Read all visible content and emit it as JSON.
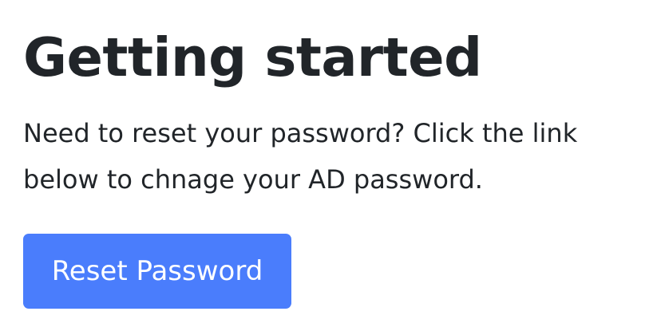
{
  "page": {
    "title": "Getting started",
    "lead_text": "Need to reset your password? Click the link below to chnage your AD password."
  },
  "actions": {
    "reset_button_label": "Reset Password"
  },
  "colors": {
    "text": "#212529",
    "button_background": "#4a7dfc",
    "button_text": "#ffffff",
    "background": "#ffffff"
  }
}
